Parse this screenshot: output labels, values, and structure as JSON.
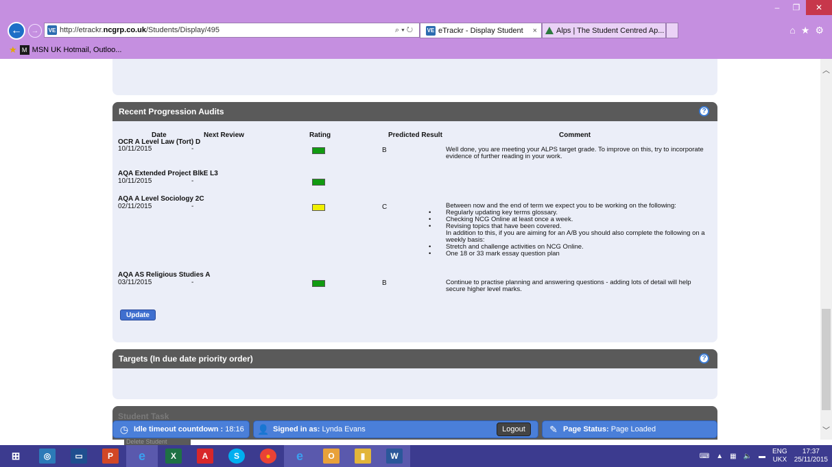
{
  "browser": {
    "url_prefix": "http://etrackr.",
    "url_domain": "ncgrp.co.uk",
    "url_path": "/Students/Display/495",
    "tabs": [
      {
        "label": "eTrackr - Display Student",
        "close": "×"
      },
      {
        "label": "Alps | The Student Centred Ap..."
      }
    ],
    "favorites": [
      {
        "label": "MSN UK Hotmail, Outloo..."
      }
    ]
  },
  "audits": {
    "title": "Recent Progression Audits",
    "columns": {
      "date": "Date",
      "next_review": "Next Review",
      "rating": "Rating",
      "predicted": "Predicted Result",
      "comment": "Comment"
    },
    "rows": [
      {
        "course": "OCR A Level Law (Tort) D",
        "date": "10/11/2015",
        "next_review": "-",
        "rating_color": "#119a11",
        "predicted": "B",
        "comment_lines": [
          "Well done, you are meeting your ALPS target grade. To improve on this, try to incorporate evidence of further reading in your work."
        ]
      },
      {
        "course": "AQA Extended Project BlkE L3",
        "date": "10/11/2015",
        "next_review": "-",
        "rating_color": "#119a11",
        "predicted": "",
        "comment_lines": []
      },
      {
        "course": "AQA A Level Sociology 2C",
        "date": "02/11/2015",
        "next_review": "-",
        "rating_color": "#f0f000",
        "predicted": "C",
        "comment_intro": "Between now and the end of term we expect you to be working on the following:",
        "comment_bullets": [
          "Regularly updating key terms glossary.",
          "Checking NCG Online at least once a week.",
          "Revising topics that have been covered."
        ],
        "comment_mid": "In addition to this, if you are aiming for an A/B you should also complete the following on a weekly basis:",
        "comment_bullets2": [
          "Stretch and challenge activities on NCG Online.",
          "One 18 or 33 mark essay question plan"
        ]
      },
      {
        "course": "AQA AS Religious Studies A",
        "date": "03/11/2015",
        "next_review": "-",
        "rating_color": "#119a11",
        "predicted": "B",
        "comment_lines": [
          "Continue to practise planning and answering questions - adding lots of detail will help secure higher level marks."
        ]
      }
    ],
    "update_label": "Update"
  },
  "targets": {
    "title": "Targets (In due date priority order)"
  },
  "student_task": {
    "title": "Student Task",
    "delete_label": "Delete Student"
  },
  "status": {
    "idle_label": "Idle timeout countdown :",
    "idle_value": "18:16",
    "signed_label": "Signed in as:",
    "signed_value": "Lynda Evans",
    "logout_label": "Logout",
    "page_label": "Page Status:",
    "page_value": "Page Loaded"
  },
  "taskbar": {
    "tray_lang_top": "ENG",
    "tray_lang_bottom": "UKX",
    "time": "17:37",
    "date": "25/11/2015"
  },
  "help_glyph": "?"
}
